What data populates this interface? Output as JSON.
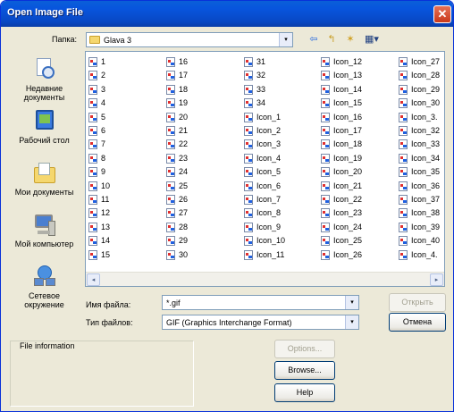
{
  "window": {
    "title": "Open Image File",
    "close_glyph": "✕"
  },
  "lookin": {
    "label": "Папка:",
    "value": "Glava 3"
  },
  "toolbar": {
    "back_glyph": "⇦",
    "up_glyph": "↰",
    "newfolder_glyph": "✶",
    "view_glyph": "▦▾"
  },
  "places": [
    {
      "label": "Недавние документы",
      "icon": "recent-documents-icon"
    },
    {
      "label": "Рабочий стол",
      "icon": "desktop-icon"
    },
    {
      "label": "Мои документы",
      "icon": "my-documents-icon"
    },
    {
      "label": "Мой компьютер",
      "icon": "my-computer-icon"
    },
    {
      "label": "Сетевое окружение",
      "icon": "network-places-icon"
    }
  ],
  "files": [
    [
      "1",
      "2",
      "3",
      "4",
      "5",
      "6",
      "7",
      "8",
      "9",
      "10",
      "11",
      "12",
      "13",
      "14",
      "15"
    ],
    [
      "16",
      "17",
      "18",
      "19",
      "20",
      "21",
      "22",
      "23",
      "24",
      "25",
      "26",
      "27",
      "28",
      "29",
      "30"
    ],
    [
      "31",
      "32",
      "33",
      "34",
      "Icon_1",
      "Icon_2",
      "Icon_3",
      "Icon_4",
      "Icon_5",
      "Icon_6",
      "Icon_7",
      "Icon_8",
      "Icon_9",
      "Icon_10",
      "Icon_11"
    ],
    [
      "Icon_12",
      "Icon_13",
      "Icon_14",
      "Icon_15",
      "Icon_16",
      "Icon_17",
      "Icon_18",
      "Icon_19",
      "Icon_20",
      "Icon_21",
      "Icon_22",
      "Icon_23",
      "Icon_24",
      "Icon_25",
      "Icon_26"
    ],
    [
      "Icon_27",
      "Icon_28",
      "Icon_29",
      "Icon_30",
      "Icon_3.",
      "Icon_32",
      "Icon_33",
      "Icon_34",
      "Icon_35",
      "Icon_36",
      "Icon_37",
      "Icon_38",
      "Icon_39",
      "Icon_40",
      "Icon_4."
    ]
  ],
  "filename": {
    "label": "Имя файла:",
    "value": "*.gif"
  },
  "filetype": {
    "label": "Тип файлов:",
    "value": "GIF (Graphics Interchange Format)"
  },
  "buttons": {
    "open": "Открыть",
    "cancel": "Отмена",
    "options": "Options...",
    "browse": "Browse...",
    "help": "Help"
  },
  "fileinfo": {
    "label": "File information"
  },
  "scroll": {
    "left": "◂",
    "right": "▸"
  },
  "dropdown_glyph": "▾"
}
